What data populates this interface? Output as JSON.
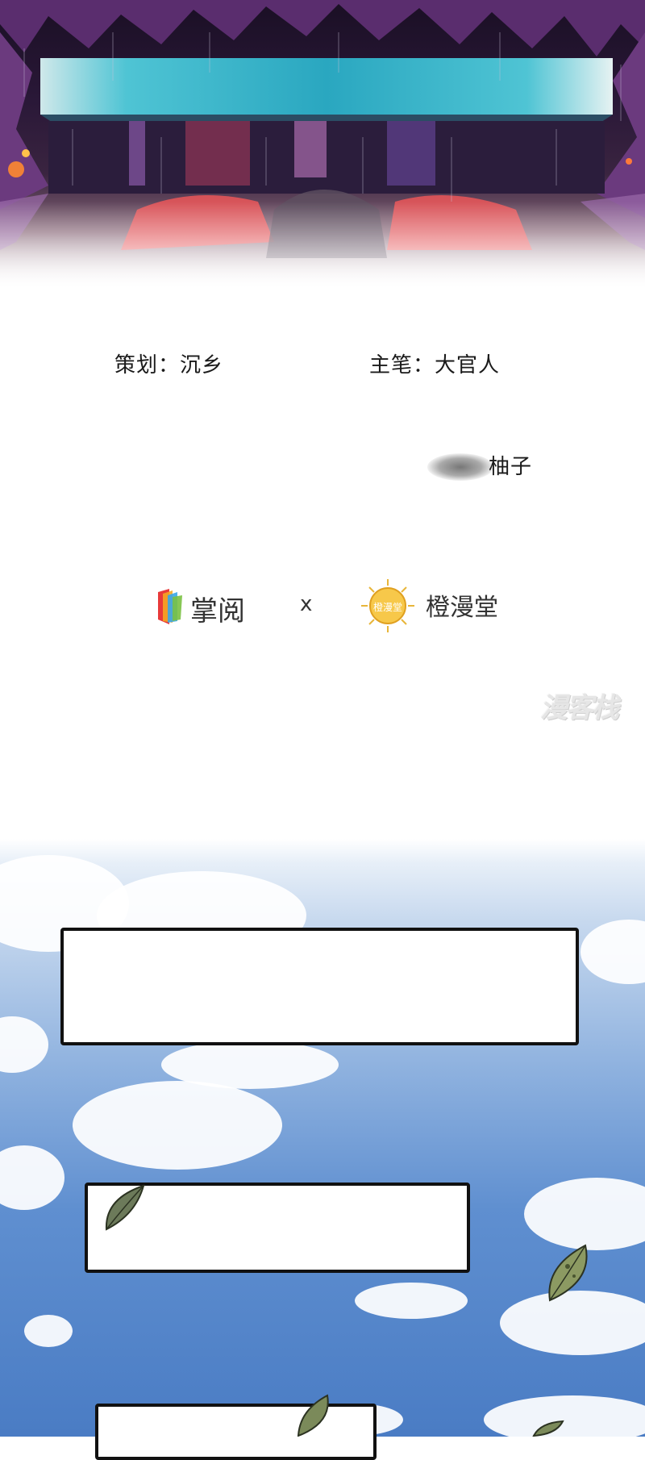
{
  "credits": {
    "plan": "策划：沉乡",
    "main_artist": "主笔：大官人",
    "assistant": "柚子"
  },
  "brands": {
    "left_name": "掌阅",
    "separator": "x",
    "right_name": "橙漫堂",
    "right_logo_text": "橙漫堂"
  },
  "watermark": "漫客栈",
  "speech_boxes": [
    {
      "text": ""
    },
    {
      "text": ""
    },
    {
      "text": ""
    }
  ]
}
